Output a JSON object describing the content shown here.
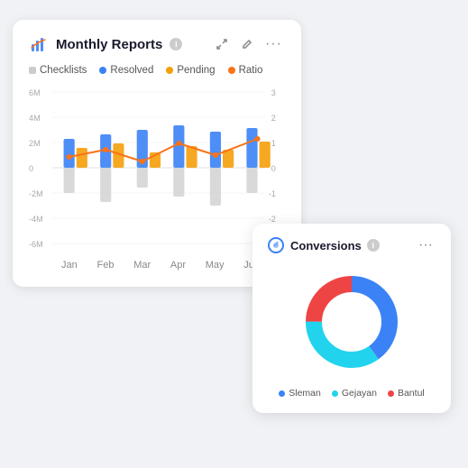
{
  "monthly_card": {
    "title": "Monthly Reports",
    "icon": "chart-icon",
    "info": "i",
    "actions": {
      "expand": "⤢",
      "edit": "✎",
      "more": "···"
    },
    "legend": [
      {
        "label": "Checklists",
        "color": "#cccccc",
        "shape": "square"
      },
      {
        "label": "Resolved",
        "color": "#3b82f6",
        "shape": "dot"
      },
      {
        "label": "Pending",
        "color": "#f59e0b",
        "shape": "dot"
      },
      {
        "label": "Ratio",
        "color": "#f97316",
        "shape": "dot"
      }
    ],
    "y_left_labels": [
      "6M",
      "4M",
      "2M",
      "0",
      "-2M",
      "-4M",
      "-6M"
    ],
    "y_right_labels": [
      "3",
      "2",
      "1",
      "0",
      "-1",
      "-2"
    ],
    "x_labels": [
      "Jan",
      "Feb",
      "Mar",
      "Apr",
      "May",
      "Jun"
    ]
  },
  "conversions_card": {
    "title": "Conversions",
    "icon": "conversion-icon",
    "info": "i",
    "donut": {
      "segments": [
        {
          "label": "Sleman",
          "color": "#3b82f6",
          "value": 40
        },
        {
          "label": "Gejayan",
          "color": "#22d3ee",
          "value": 35
        },
        {
          "label": "Bantul",
          "color": "#ef4444",
          "value": 25
        }
      ]
    },
    "legend": [
      {
        "label": "Sleman",
        "color": "#3b82f6"
      },
      {
        "label": "Gejayan",
        "color": "#22d3ee"
      },
      {
        "label": "Bantul",
        "color": "#ef4444"
      }
    ]
  }
}
